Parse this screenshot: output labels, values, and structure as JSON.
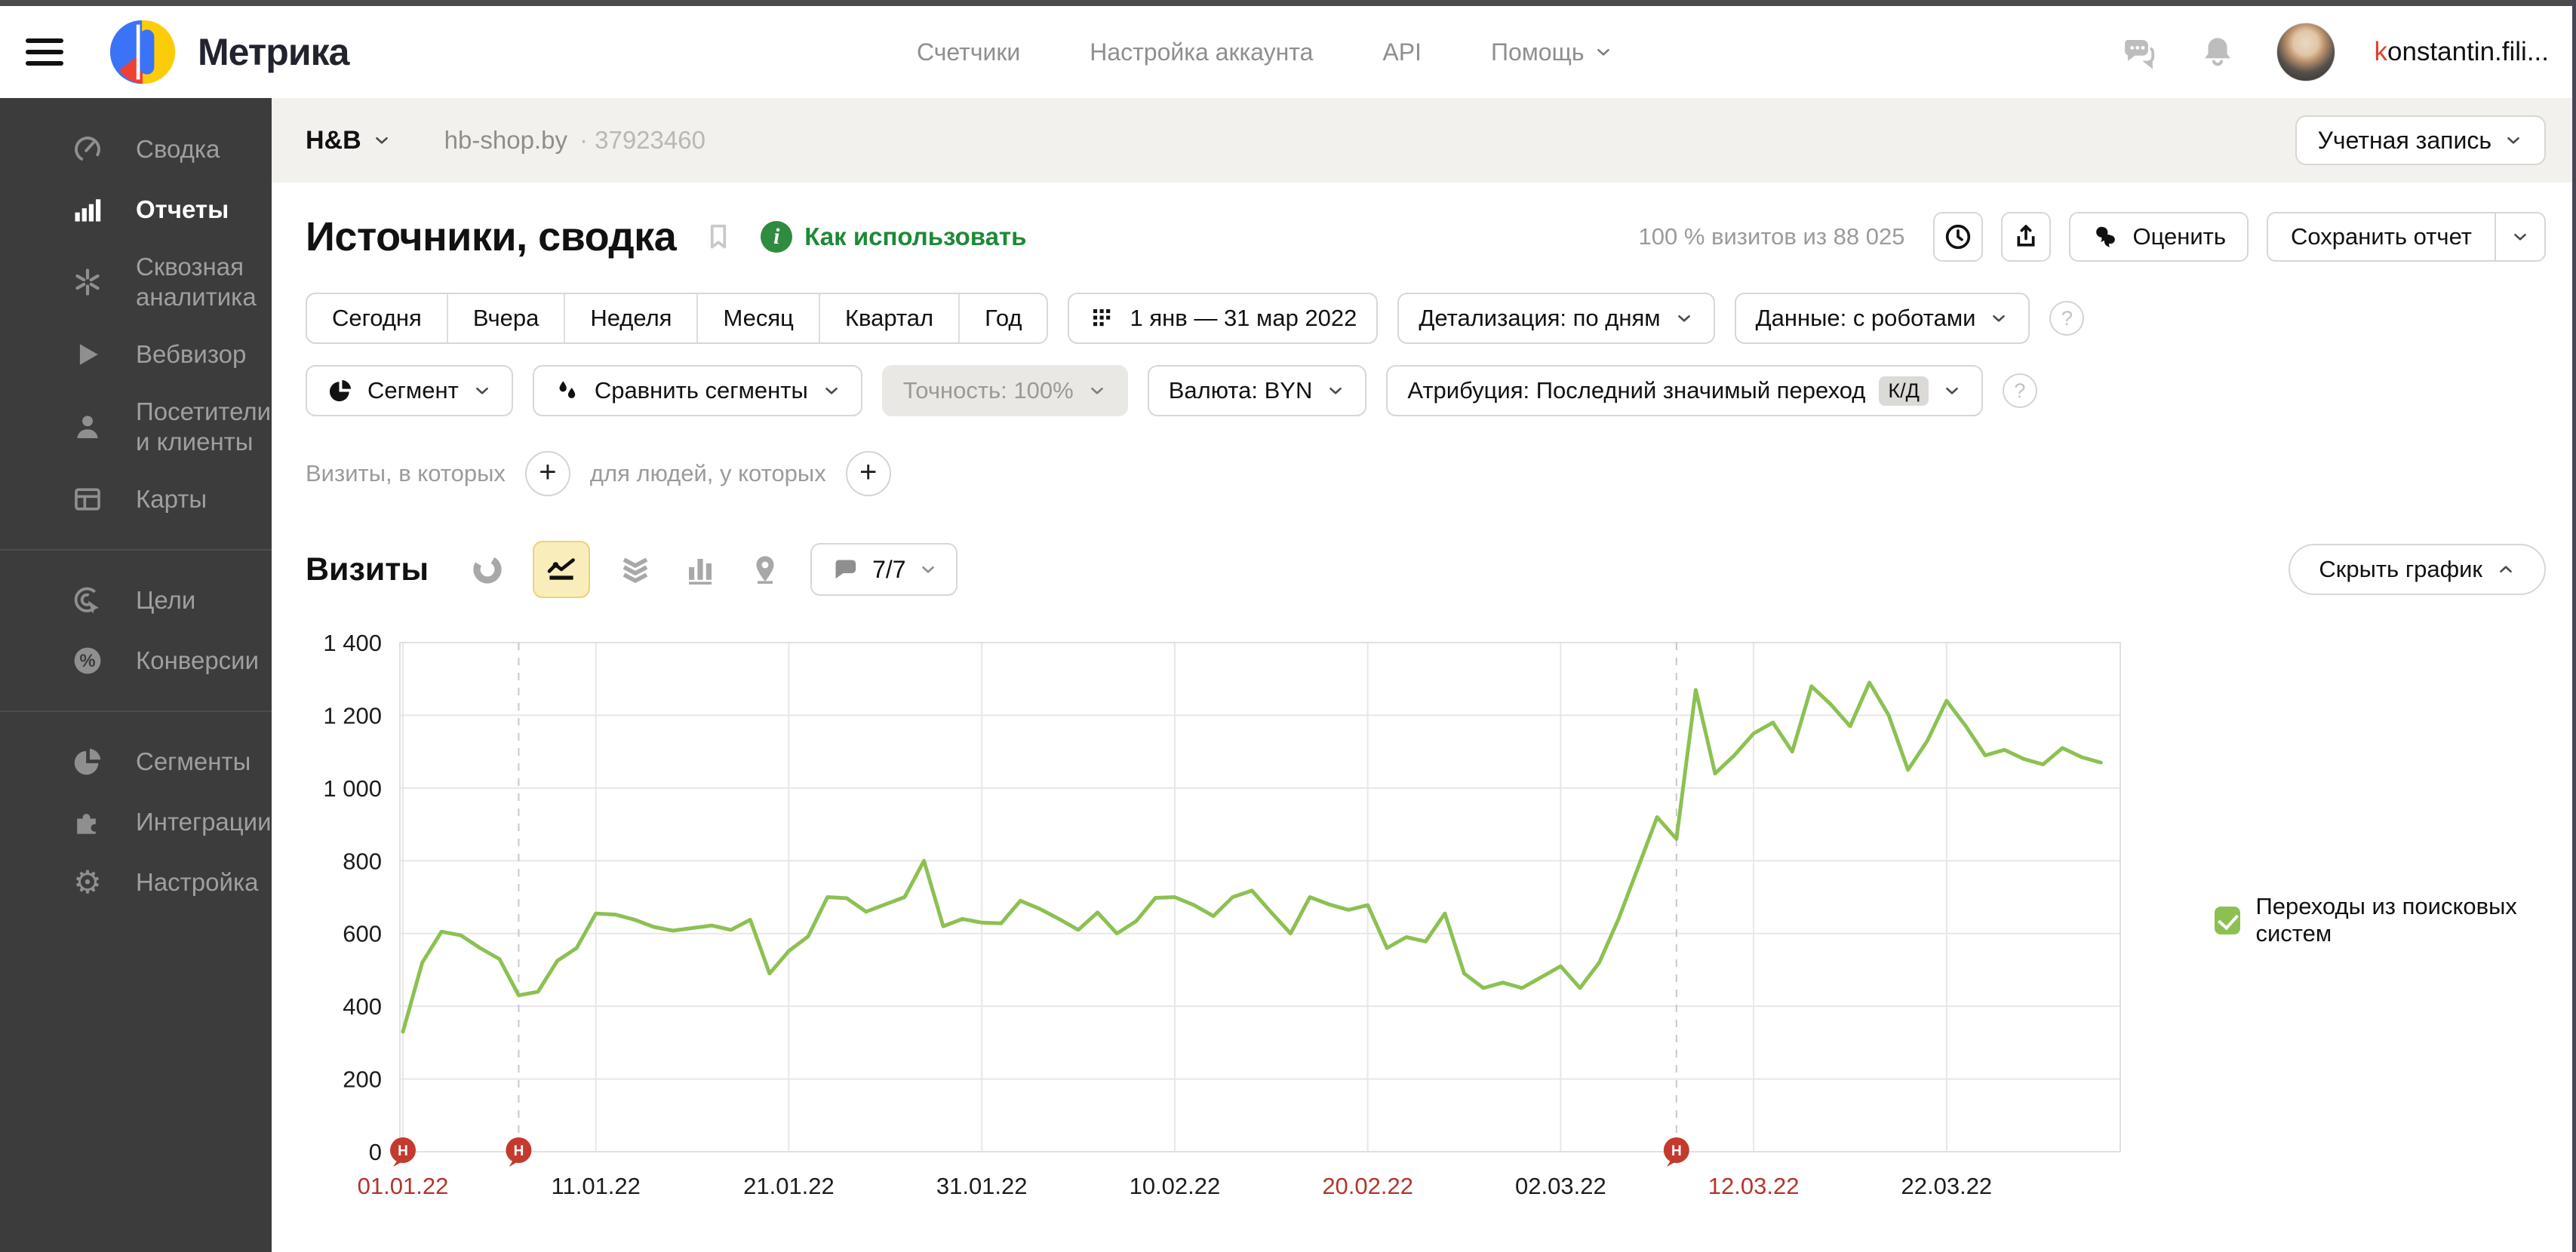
{
  "header": {
    "logo_text": "Метрика",
    "nav": [
      "Счетчики",
      "Настройка аккаунта",
      "API",
      "Помощь"
    ],
    "user_display": "konstantin.fili..."
  },
  "sidebar": {
    "groups": [
      {
        "items": [
          {
            "label": "Сводка",
            "icon": "speedometer",
            "active": false
          },
          {
            "label": "Отчеты",
            "icon": "bars",
            "active": true
          },
          {
            "label": "Сквозная аналитика",
            "lines": [
              "Сквозная",
              "аналитика"
            ],
            "icon": "cross-analytics",
            "active": false
          },
          {
            "label": "Вебвизор",
            "icon": "play",
            "active": false
          },
          {
            "label": "Посетители и клиенты",
            "lines": [
              "Посетители",
              "и клиенты"
            ],
            "icon": "person",
            "active": false
          },
          {
            "label": "Карты",
            "icon": "layout",
            "active": false
          }
        ]
      },
      {
        "items": [
          {
            "label": "Цели",
            "icon": "target",
            "active": false
          },
          {
            "label": "Конверсии",
            "icon": "percent",
            "active": false
          }
        ]
      },
      {
        "items": [
          {
            "label": "Сегменты",
            "icon": "pie",
            "active": false
          },
          {
            "label": "Интеграции",
            "icon": "puzzle",
            "active": false
          },
          {
            "label": "Настройка",
            "icon": "gear",
            "active": false
          }
        ]
      }
    ]
  },
  "breadcrumb": {
    "counter_name": "H&B",
    "site": "hb-shop.by",
    "counter_id": "· 37923460",
    "account_button": "Учетная запись"
  },
  "report": {
    "title": "Источники, сводка",
    "how_to_use": "Как использовать",
    "visits_share": "100 % визитов из 88 025",
    "rate_button": "Оценить",
    "save_button": "Сохранить отчет"
  },
  "filters": {
    "periods": [
      "Сегодня",
      "Вчера",
      "Неделя",
      "Месяц",
      "Квартал",
      "Год"
    ],
    "date_range": "1 янв — 31 мар 2022",
    "detail": "Детализация: по дням",
    "data_mode": "Данные: с роботами",
    "segment": "Сегмент",
    "compare_segments": "Сравнить сегменты",
    "accuracy": "Точность: 100%",
    "currency": "Валюта: BYN",
    "attribution": "Атрибуция: Последний значимый переход",
    "attribution_badge": "К/Д",
    "help_mark": "?"
  },
  "segment_builder": {
    "visits_label": "Визиты, в которых",
    "people_label": "для людей, у которых"
  },
  "visits_section": {
    "title": "Визиты",
    "metrics_count": "7/7",
    "hide_chart": "Скрыть график"
  },
  "legend": {
    "label": "Переходы из поисковых систем"
  },
  "colors": {
    "series_green": "#8cc152",
    "holiday_red": "#c43a2e",
    "red_label": "#b5342a",
    "grid": "#e7e7e7",
    "active_yellow": "#f9edbb"
  },
  "chart_data": {
    "type": "line",
    "title": "Визиты",
    "ylim": [
      0,
      1400
    ],
    "y_ticks": [
      0,
      200,
      400,
      600,
      800,
      1000,
      1200,
      1400
    ],
    "total_days": 90,
    "x_start": "01.01.22",
    "x_end": "31.03.22",
    "x_tick_days": [
      0,
      10,
      20,
      30,
      40,
      50,
      60,
      70,
      80
    ],
    "x_tick_labels": [
      "01.01.22",
      "11.01.22",
      "21.01.22",
      "31.01.22",
      "10.02.22",
      "20.02.22",
      "02.03.22",
      "12.03.22",
      "22.03.22"
    ],
    "red_x_tick_labels": [
      "01.01.22",
      "20.02.22",
      "12.03.22"
    ],
    "holiday_marker_days": [
      0,
      6,
      66
    ],
    "holiday_marker_char": "Н",
    "dashed_line_days": [
      6,
      66
    ],
    "grid": true,
    "legend_position": "right",
    "series": [
      {
        "name": "Переходы из поисковых систем",
        "color": "#8cc152",
        "start_date": "01.01.22",
        "values": [
          330,
          520,
          605,
          595,
          560,
          530,
          430,
          440,
          525,
          560,
          655,
          652,
          638,
          618,
          608,
          615,
          622,
          610,
          638,
          490,
          552,
          592,
          700,
          697,
          660,
          680,
          700,
          800,
          620,
          640,
          630,
          628,
          690,
          668,
          640,
          610,
          658,
          600,
          634,
          698,
          700,
          678,
          648,
          700,
          718,
          658,
          600,
          700,
          680,
          665,
          678,
          560,
          590,
          578,
          655,
          490,
          450,
          465,
          450,
          480,
          510,
          450,
          520,
          640,
          780,
          920,
          860,
          1270,
          1040,
          1090,
          1150,
          1180,
          1100,
          1280,
          1230,
          1170,
          1290,
          1200,
          1050,
          1130,
          1240,
          1170,
          1090,
          1105,
          1080,
          1065,
          1110,
          1085,
          1070
        ]
      }
    ]
  }
}
